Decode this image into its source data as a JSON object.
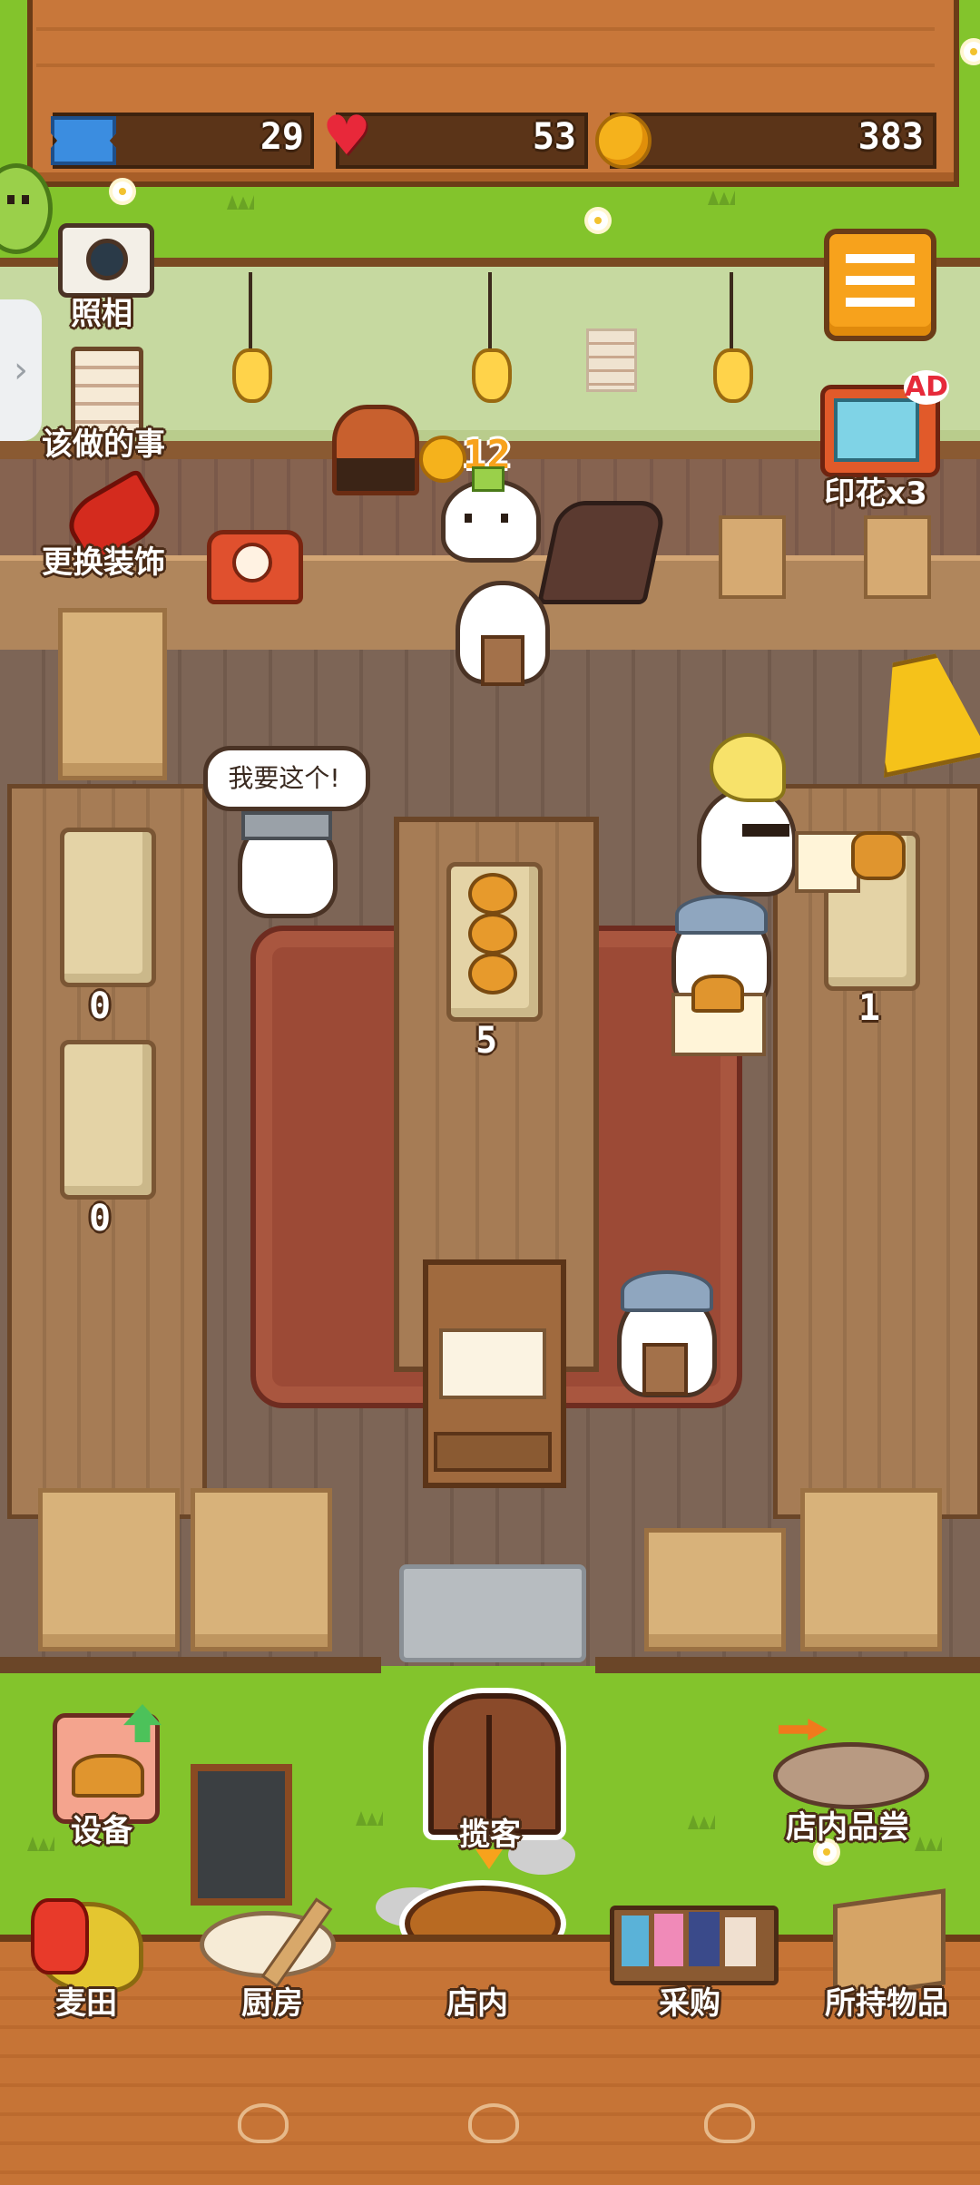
{
  "hud": {
    "tickets": "29",
    "hearts": "53",
    "coins": "383"
  },
  "menu_left": {
    "camera_label": "照相",
    "todo_label": "该做的事",
    "decor_label": "更换装饰"
  },
  "ad_reward": {
    "badge": "AD",
    "label": "印花x3"
  },
  "coin_popup": "12",
  "speech_bubble": "我要这个!",
  "shelves": {
    "left_top_count": "0",
    "left_bottom_count": "0",
    "center_count": "5",
    "right_count": "1"
  },
  "yard_buttons": {
    "equipment": "设备",
    "invite": "揽客",
    "tasting": "店内品尝"
  },
  "bottom_nav": {
    "wheat_field": "麦田",
    "kitchen": "厨房",
    "store": "店内",
    "purchase": "采购",
    "inventory": "所持物品"
  },
  "colors": {
    "wood_dark": "#7a4a22",
    "grass": "#83c42c",
    "floor": "#7d6556",
    "accent_orange": "#f5a623"
  }
}
